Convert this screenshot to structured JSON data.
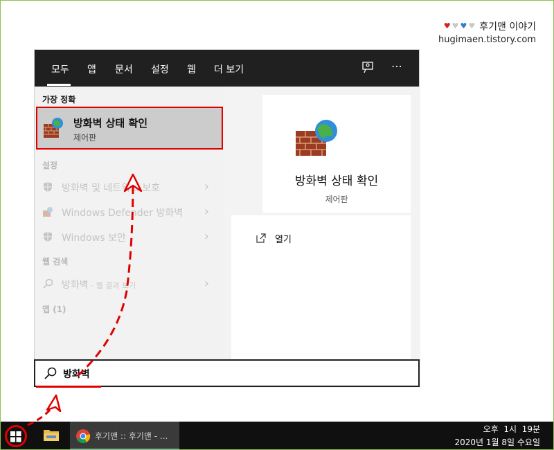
{
  "watermark": {
    "title": "후기맨 이야기",
    "url": "hugimaen.tistory.com",
    "hearts": [
      "♥",
      "♥",
      "♥",
      "♥"
    ],
    "heart_colors": [
      "#d62020",
      "#c8c8c8",
      "#2c7fcf",
      "#c8c8c8"
    ]
  },
  "search": {
    "tabs": [
      "모두",
      "앱",
      "문서",
      "설정",
      "웹",
      "더 보기"
    ],
    "feedback_icon": "feedback-icon",
    "more_icon": "⋯",
    "best_match_heading": "가장 정확",
    "best_match": {
      "title": "방화벽 상태 확인",
      "subtitle": "제어판",
      "icon": "firewall-icon"
    },
    "settings_heading": "설정",
    "settings_items": [
      {
        "label": "방화벽 및 네트워크 보호",
        "icon": "shield-icon"
      },
      {
        "label": "Windows Defender 방화벽",
        "icon": "firewall-icon"
      },
      {
        "label": "Windows 보안",
        "icon": "shield-icon"
      }
    ],
    "web_heading": "웹 검색",
    "web_item": {
      "label": "방화벽",
      "sub": " - 웹 결과 보기",
      "icon": "search-icon"
    },
    "apps_heading": "앱 (1)",
    "preview": {
      "title": "방화벽 상태 확인",
      "subtitle": "제어판",
      "action": "열기"
    },
    "query": "방화벽"
  },
  "taskbar": {
    "chrome_label": "후기맨 :: 후기맨 - ...",
    "time": "오후  1시  19분",
    "date": "2020년 1월 8일 수요일"
  },
  "colors": {
    "accent_red": "#e00000",
    "topbar": "#202020"
  }
}
